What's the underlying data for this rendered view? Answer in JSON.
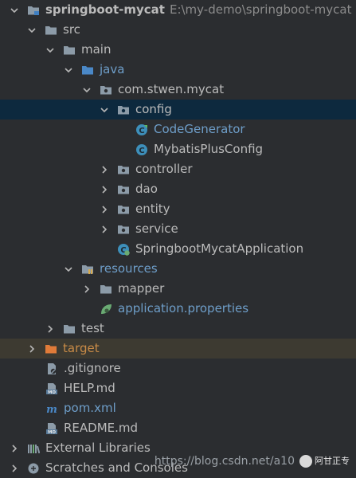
{
  "project": {
    "name": "springboot-mycat",
    "path": "E:\\my-demo\\springboot-mycat"
  },
  "tree": {
    "src": "src",
    "main": "main",
    "java": "java",
    "package": "com.stwen.mycat",
    "config": "config",
    "code_generator": "CodeGenerator",
    "mybatis_plus_config": "MybatisPlusConfig",
    "controller": "controller",
    "dao": "dao",
    "entity": "entity",
    "service": "service",
    "app_class": "SpringbootMycatApplication",
    "resources": "resources",
    "mapper": "mapper",
    "app_properties": "application.properties",
    "test": "test",
    "target": "target",
    "gitignore": ".gitignore",
    "help_md": "HELP.md",
    "pom": "pom.xml",
    "readme": "README.md",
    "external_libraries": "External Libraries",
    "scratches": "Scratches and Consoles"
  },
  "watermark": {
    "url": "https://blog.csdn.net/a10",
    "badge": "阿甘正专"
  },
  "colors": {
    "background": "#2b2d30",
    "selected_row": "#0d293e",
    "excluded_row": "#3d3a31",
    "source_folder": "#6e9ec9",
    "excluded_folder": "#c98b47"
  }
}
